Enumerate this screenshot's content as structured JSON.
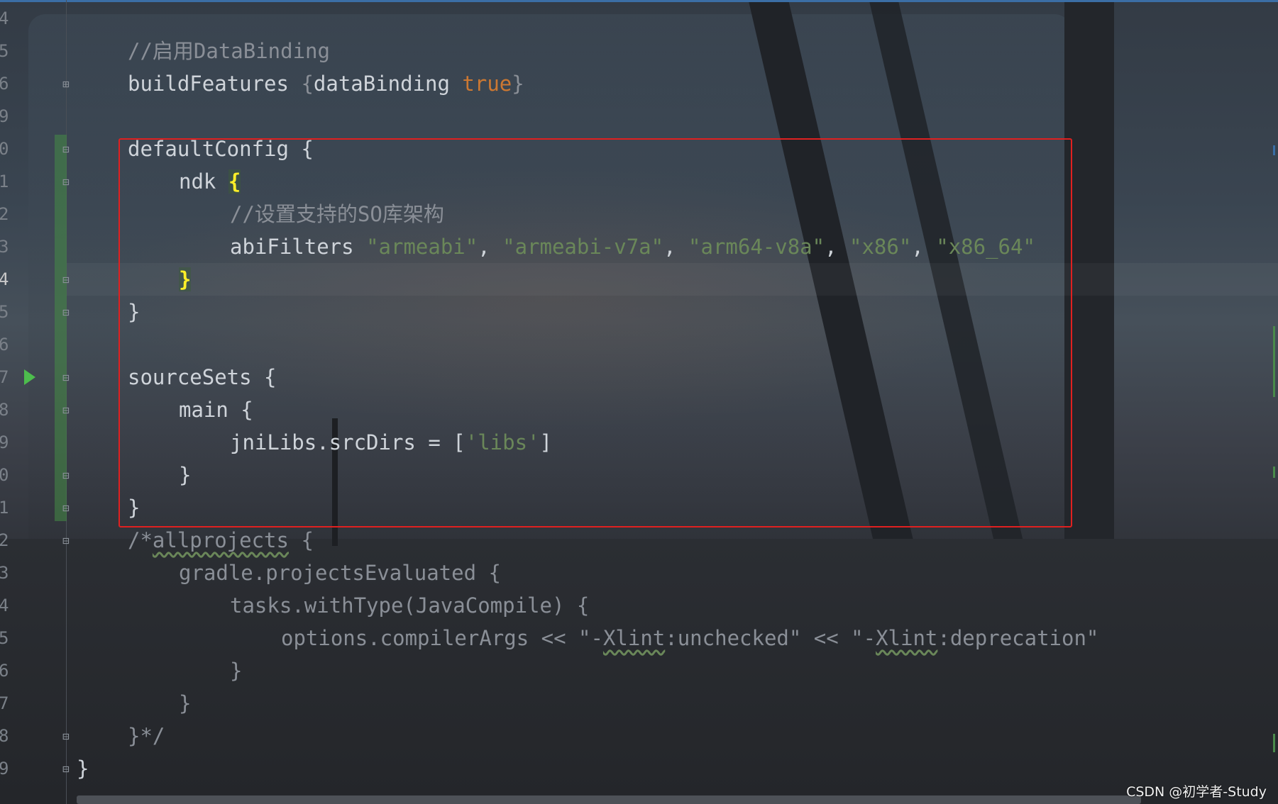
{
  "editor": {
    "line_numbers": [
      "4",
      "5",
      "6",
      "9",
      "0",
      "1",
      "2",
      "3",
      "4",
      "5",
      "6",
      "7",
      "8",
      "9",
      "0",
      "1",
      "2",
      "3",
      "4",
      "5",
      "6",
      "7",
      "8",
      "9"
    ],
    "active_line_number": "4",
    "code": {
      "l1_comment": "//启用DataBinding",
      "l2_build_features": "buildFeatures ",
      "l2_open": "{",
      "l2_data_binding": "dataBinding ",
      "l2_true": "true",
      "l2_close": "}",
      "l3_default_config": "defaultConfig {",
      "l4_ndk": "ndk ",
      "l4_open": "{",
      "l5_comment": "//设置支持的SO库架构",
      "l6_abi_filters": "abiFilters ",
      "l6_s1": "\"armeabi\"",
      "l6_s2": "\"armeabi-v7a\"",
      "l6_s3": "\"arm64-v8a\"",
      "l6_s4": "\"x86\"",
      "l6_s5": "\"x86_64\"",
      "comma": ", ",
      "l7_close": "}",
      "l8_close": "}",
      "l9_source_sets": "sourceSets {",
      "l10_main": "main {",
      "l11_jnilibs": "jniLibs.srcDirs = [",
      "l11_libs": "'libs'",
      "l11_close": "]",
      "l12_close": "}",
      "l13_close": "}",
      "l14_comment_start": "/*",
      "l14_allprojects": "allprojects",
      "l14_rest": " {",
      "l15": "gradle.projectsEvaluated {",
      "l16": "tasks.withType(JavaCompile) {",
      "l17_a": "options.compilerArgs << \"-",
      "l17_x1": "Xlint",
      "l17_b": ":unchecked\" << \"-",
      "l17_x2": "Xlint",
      "l17_c": ":deprecation\"",
      "l18": "}",
      "l19": "}",
      "l20": "}*/",
      "l21": "}"
    }
  },
  "watermark": "CSDN @初学者-Study",
  "colors": {
    "comment": "#8a8f97",
    "keyword": "#cc7832",
    "string": "#6a8759",
    "text": "#cfd4da",
    "selection_box": "#e02020",
    "run_icon": "#4dbd4d"
  },
  "icons": [
    "fold-open-icon",
    "fold-close-icon",
    "run-gutter-icon"
  ]
}
